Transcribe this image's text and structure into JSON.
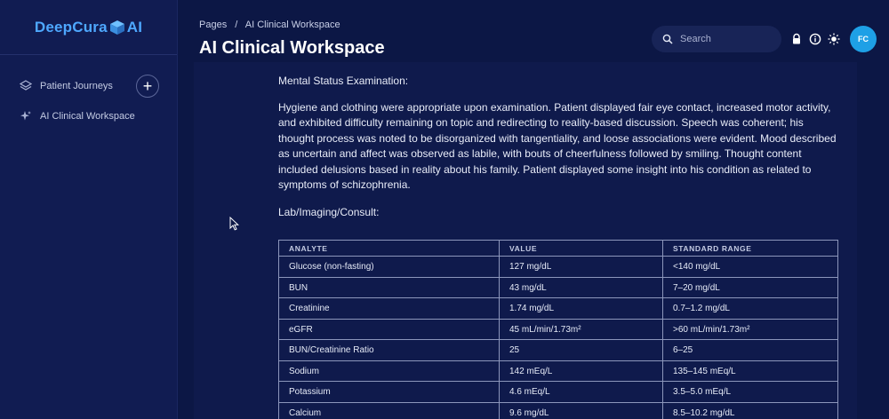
{
  "app": {
    "logo_text_left": "DeepCura",
    "logo_text_right": "AI"
  },
  "sidebar": {
    "items": [
      {
        "label": "Patient Journeys",
        "icon": "layers-icon"
      },
      {
        "label": "AI Clinical Workspace",
        "icon": "sparkle-icon"
      }
    ],
    "add_label": "+"
  },
  "header": {
    "breadcrumb": {
      "root": "Pages",
      "separator": "/",
      "current": "AI Clinical Workspace"
    },
    "title": "AI Clinical Workspace"
  },
  "topbar": {
    "search_placeholder": "Search",
    "avatar_initials": "FC"
  },
  "document": {
    "mse_title": "Mental Status Examination:",
    "mse_text": "Hygiene and clothing were appropriate upon examination. Patient displayed fair eye contact, increased motor activity, and exhibited difficulty remaining on topic and redirecting to reality-based discussion. Speech was coherent; his thought process was noted to be disorganized with tangentiality, and loose associations were evident. Mood described as uncertain and affect was observed as labile, with bouts of cheerfulness followed by smiling. Thought content included delusions based in reality about his family. Patient displayed some insight into his condition as related to symptoms of schizophrenia.",
    "lab_title": "Lab/Imaging/Consult:",
    "table": {
      "headers": [
        "ANALYTE",
        "VALUE",
        "STANDARD RANGE"
      ],
      "rows": [
        [
          "Glucose (non-fasting)",
          "127 mg/dL",
          "<140 mg/dL"
        ],
        [
          "BUN",
          "43 mg/dL",
          "7–20 mg/dL"
        ],
        [
          "Creatinine",
          "1.74 mg/dL",
          "0.7–1.2 mg/dL"
        ],
        [
          "eGFR",
          "45 mL/min/1.73m²",
          ">60 mL/min/1.73m²"
        ],
        [
          "BUN/Creatinine Ratio",
          "25",
          "6–25"
        ],
        [
          "Sodium",
          "142 mEq/L",
          "135–145 mEq/L"
        ],
        [
          "Potassium",
          "4.6 mEq/L",
          "3.5–5.0 mEq/L"
        ],
        [
          "Calcium",
          "9.6 mg/dL",
          "8.5–10.2 mg/dL"
        ]
      ]
    }
  },
  "colors": {
    "background": "#0c1745",
    "sidebar": "#111c52",
    "accent": "#4ea8ff",
    "avatar": "#1ea0e6"
  }
}
